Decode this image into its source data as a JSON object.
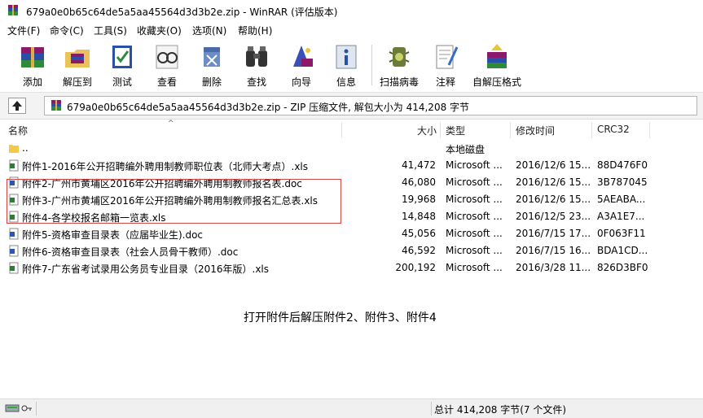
{
  "window": {
    "title": "679a0e0b65c64de5a5aa45564d3d3b2e.zip - WinRAR (评估版本)"
  },
  "menu": [
    "文件(F)",
    "命令(C)",
    "工具(S)",
    "收藏夹(O)",
    "选项(N)",
    "帮助(H)"
  ],
  "toolbar": [
    {
      "label": "添加",
      "icon": "add-books-icon"
    },
    {
      "label": "解压到",
      "icon": "extract-folder-icon"
    },
    {
      "label": "测试",
      "icon": "test-icon"
    },
    {
      "label": "查看",
      "icon": "view-glasses-icon"
    },
    {
      "label": "删除",
      "icon": "delete-icon"
    },
    {
      "label": "查找",
      "icon": "find-binoculars-icon"
    },
    {
      "label": "向导",
      "icon": "wizard-icon"
    },
    {
      "label": "信息",
      "icon": "info-icon"
    },
    {
      "label": "扫描病毒",
      "icon": "virus-scan-icon"
    },
    {
      "label": "注释",
      "icon": "comment-icon"
    },
    {
      "label": "自解压格式",
      "icon": "sfx-icon"
    }
  ],
  "address": {
    "text": "679a0e0b65c64de5a5aa45564d3d3b2e.zip - ZIP 压缩文件, 解包大小为 414,208 字节"
  },
  "columns": {
    "name": "名称",
    "size": "大小",
    "type": "类型",
    "modified": "修改时间",
    "crc": "CRC32"
  },
  "files": [
    {
      "icon": "folder-icon",
      "name": "..",
      "size": "",
      "type": "本地磁盘",
      "modified": "",
      "crc": ""
    },
    {
      "icon": "xls-file-icon",
      "name": "附件1-2016年公开招聘编外聘用制教师职位表（北师大考点）.xls",
      "size": "41,472",
      "type": "Microsoft ...",
      "modified": "2016/12/6 15...",
      "crc": "88D476F0"
    },
    {
      "icon": "doc-file-icon",
      "name": "附件2-广州市黄埔区2016年公开招聘编外聘用制教师报名表.doc",
      "size": "46,080",
      "type": "Microsoft ...",
      "modified": "2016/12/6 15...",
      "crc": "3B787045"
    },
    {
      "icon": "xls-file-icon",
      "name": "附件3-广州市黄埔区2016年公开招聘编外聘用制教师报名汇总表.xls",
      "size": "19,968",
      "type": "Microsoft ...",
      "modified": "2016/12/6 15...",
      "crc": "5AEABA..."
    },
    {
      "icon": "xls-file-icon",
      "name": "附件4-各学校报名邮箱一览表.xls",
      "size": "14,848",
      "type": "Microsoft ...",
      "modified": "2016/12/5 23...",
      "crc": "A3A1E7..."
    },
    {
      "icon": "doc-file-icon",
      "name": "附件5-资格审查目录表（应届毕业生).doc",
      "size": "45,056",
      "type": "Microsoft ...",
      "modified": "2016/7/15 17...",
      "crc": "0F063F11"
    },
    {
      "icon": "doc-file-icon",
      "name": "附件6-资格审查目录表（社会人员骨干教师）.doc",
      "size": "46,592",
      "type": "Microsoft ...",
      "modified": "2016/7/15 16...",
      "crc": "BDA1CD..."
    },
    {
      "icon": "xls-file-icon",
      "name": "附件7-广东省考试录用公务员专业目录（2016年版）.xls",
      "size": "200,192",
      "type": "Microsoft ...",
      "modified": "2016/3/28 11...",
      "crc": "826D3BF0"
    }
  ],
  "note": "打开附件后解压附件2、附件3、附件4",
  "status": {
    "total": "总计 414,208 字节(7 个文件)"
  },
  "colors": {
    "highlight_border": "#d64545"
  }
}
